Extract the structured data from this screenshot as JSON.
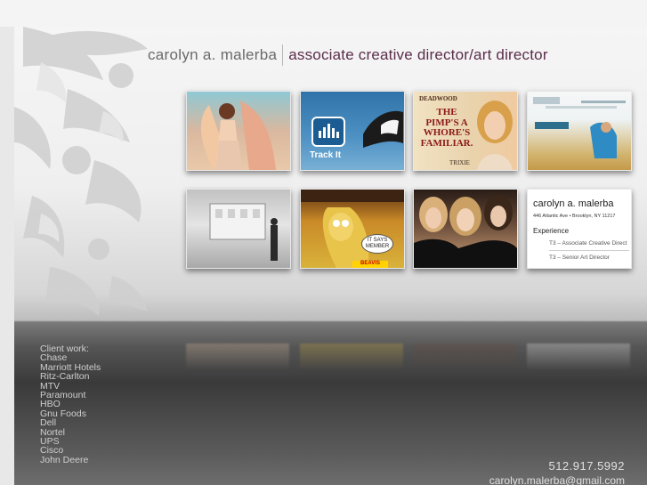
{
  "header": {
    "name": "carolyn a. malerba",
    "title": "associate creative director/art director"
  },
  "portfolio": {
    "thumbnails": [
      {
        "subject": "woman-with-wings-ad"
      },
      {
        "subject": "track-it-app",
        "label": "Track It"
      },
      {
        "subject": "deadwood-poster",
        "brand": "DEADWOOD",
        "headline": "THE PIMP'S A WHORE'S FAMILIAR.",
        "character": "TRIXIE"
      },
      {
        "subject": "ritz-carlton-website"
      },
      {
        "subject": "window-display-figure"
      },
      {
        "subject": "beavis-and-butthead",
        "bubble": "IT SAYS MEMBER",
        "tag": "BEAVIS"
      },
      {
        "subject": "three-women-portrait"
      },
      {
        "subject": "resume",
        "name": "carolyn a. malerba",
        "address": "446 Atlantic Ave  •  Brooklyn, NY 11217",
        "section": "Experience",
        "jobs": [
          "T3 – Associate Creative Direct",
          "T3 – Senior Art Director"
        ]
      }
    ]
  },
  "clients": {
    "heading": "Client work:",
    "list": [
      "Chase",
      "Marriott Hotels",
      "Ritz-Carlton",
      "MTV",
      "Paramount",
      "HBO",
      "Gnu Foods",
      "Dell",
      "Nortel",
      "UPS",
      "Cisco",
      "John Deere"
    ]
  },
  "contact": {
    "phone": "512.917.5992",
    "email": "carolyn.malerba@gmail.com"
  },
  "colors": {
    "title_accent": "#5a2d4a",
    "name_gray": "#6a6a6a",
    "footer_text": "#cfcfcf"
  }
}
